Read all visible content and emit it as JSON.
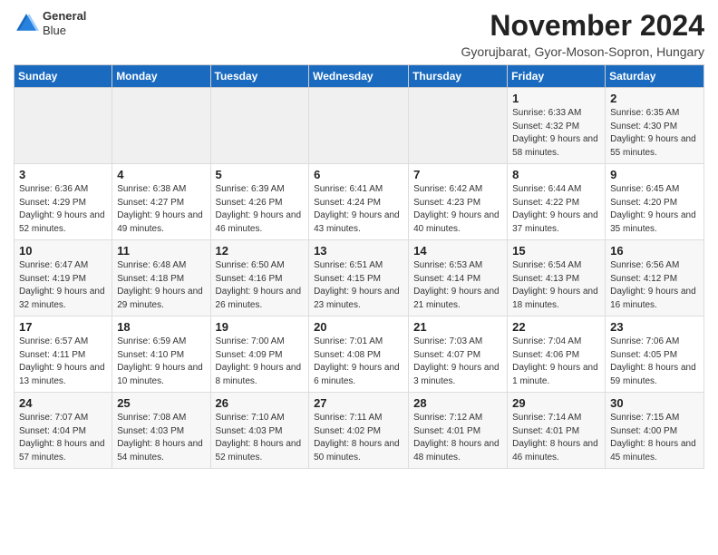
{
  "header": {
    "logo_line1": "General",
    "logo_line2": "Blue",
    "month": "November 2024",
    "location": "Gyorujbarat, Gyor-Moson-Sopron, Hungary"
  },
  "days_of_week": [
    "Sunday",
    "Monday",
    "Tuesday",
    "Wednesday",
    "Thursday",
    "Friday",
    "Saturday"
  ],
  "weeks": [
    [
      {
        "day": "",
        "info": ""
      },
      {
        "day": "",
        "info": ""
      },
      {
        "day": "",
        "info": ""
      },
      {
        "day": "",
        "info": ""
      },
      {
        "day": "",
        "info": ""
      },
      {
        "day": "1",
        "info": "Sunrise: 6:33 AM\nSunset: 4:32 PM\nDaylight: 9 hours and 58 minutes."
      },
      {
        "day": "2",
        "info": "Sunrise: 6:35 AM\nSunset: 4:30 PM\nDaylight: 9 hours and 55 minutes."
      }
    ],
    [
      {
        "day": "3",
        "info": "Sunrise: 6:36 AM\nSunset: 4:29 PM\nDaylight: 9 hours and 52 minutes."
      },
      {
        "day": "4",
        "info": "Sunrise: 6:38 AM\nSunset: 4:27 PM\nDaylight: 9 hours and 49 minutes."
      },
      {
        "day": "5",
        "info": "Sunrise: 6:39 AM\nSunset: 4:26 PM\nDaylight: 9 hours and 46 minutes."
      },
      {
        "day": "6",
        "info": "Sunrise: 6:41 AM\nSunset: 4:24 PM\nDaylight: 9 hours and 43 minutes."
      },
      {
        "day": "7",
        "info": "Sunrise: 6:42 AM\nSunset: 4:23 PM\nDaylight: 9 hours and 40 minutes."
      },
      {
        "day": "8",
        "info": "Sunrise: 6:44 AM\nSunset: 4:22 PM\nDaylight: 9 hours and 37 minutes."
      },
      {
        "day": "9",
        "info": "Sunrise: 6:45 AM\nSunset: 4:20 PM\nDaylight: 9 hours and 35 minutes."
      }
    ],
    [
      {
        "day": "10",
        "info": "Sunrise: 6:47 AM\nSunset: 4:19 PM\nDaylight: 9 hours and 32 minutes."
      },
      {
        "day": "11",
        "info": "Sunrise: 6:48 AM\nSunset: 4:18 PM\nDaylight: 9 hours and 29 minutes."
      },
      {
        "day": "12",
        "info": "Sunrise: 6:50 AM\nSunset: 4:16 PM\nDaylight: 9 hours and 26 minutes."
      },
      {
        "day": "13",
        "info": "Sunrise: 6:51 AM\nSunset: 4:15 PM\nDaylight: 9 hours and 23 minutes."
      },
      {
        "day": "14",
        "info": "Sunrise: 6:53 AM\nSunset: 4:14 PM\nDaylight: 9 hours and 21 minutes."
      },
      {
        "day": "15",
        "info": "Sunrise: 6:54 AM\nSunset: 4:13 PM\nDaylight: 9 hours and 18 minutes."
      },
      {
        "day": "16",
        "info": "Sunrise: 6:56 AM\nSunset: 4:12 PM\nDaylight: 9 hours and 16 minutes."
      }
    ],
    [
      {
        "day": "17",
        "info": "Sunrise: 6:57 AM\nSunset: 4:11 PM\nDaylight: 9 hours and 13 minutes."
      },
      {
        "day": "18",
        "info": "Sunrise: 6:59 AM\nSunset: 4:10 PM\nDaylight: 9 hours and 10 minutes."
      },
      {
        "day": "19",
        "info": "Sunrise: 7:00 AM\nSunset: 4:09 PM\nDaylight: 9 hours and 8 minutes."
      },
      {
        "day": "20",
        "info": "Sunrise: 7:01 AM\nSunset: 4:08 PM\nDaylight: 9 hours and 6 minutes."
      },
      {
        "day": "21",
        "info": "Sunrise: 7:03 AM\nSunset: 4:07 PM\nDaylight: 9 hours and 3 minutes."
      },
      {
        "day": "22",
        "info": "Sunrise: 7:04 AM\nSunset: 4:06 PM\nDaylight: 9 hours and 1 minute."
      },
      {
        "day": "23",
        "info": "Sunrise: 7:06 AM\nSunset: 4:05 PM\nDaylight: 8 hours and 59 minutes."
      }
    ],
    [
      {
        "day": "24",
        "info": "Sunrise: 7:07 AM\nSunset: 4:04 PM\nDaylight: 8 hours and 57 minutes."
      },
      {
        "day": "25",
        "info": "Sunrise: 7:08 AM\nSunset: 4:03 PM\nDaylight: 8 hours and 54 minutes."
      },
      {
        "day": "26",
        "info": "Sunrise: 7:10 AM\nSunset: 4:03 PM\nDaylight: 8 hours and 52 minutes."
      },
      {
        "day": "27",
        "info": "Sunrise: 7:11 AM\nSunset: 4:02 PM\nDaylight: 8 hours and 50 minutes."
      },
      {
        "day": "28",
        "info": "Sunrise: 7:12 AM\nSunset: 4:01 PM\nDaylight: 8 hours and 48 minutes."
      },
      {
        "day": "29",
        "info": "Sunrise: 7:14 AM\nSunset: 4:01 PM\nDaylight: 8 hours and 46 minutes."
      },
      {
        "day": "30",
        "info": "Sunrise: 7:15 AM\nSunset: 4:00 PM\nDaylight: 8 hours and 45 minutes."
      }
    ]
  ]
}
